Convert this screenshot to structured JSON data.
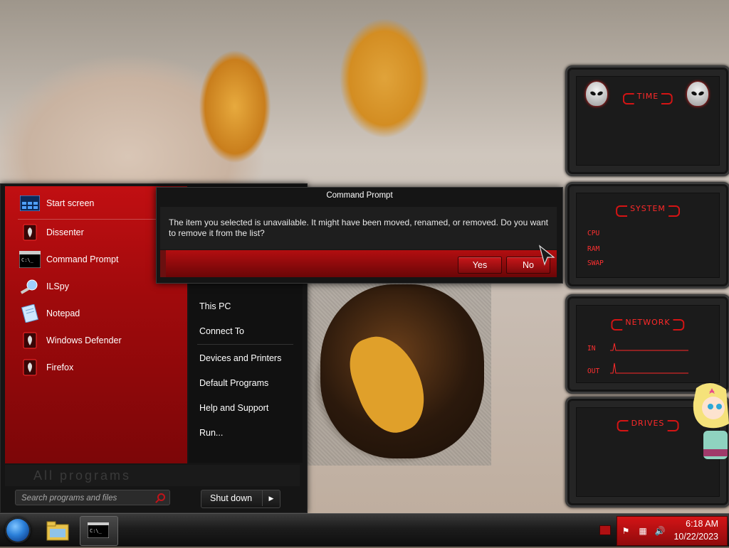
{
  "start_menu": {
    "pinned": [
      {
        "label": "Start screen",
        "icon": "start-screen-icon"
      },
      {
        "label": "Dissenter",
        "icon": "alienware-app-icon"
      },
      {
        "label": "Command Prompt",
        "icon": "cmd-icon"
      },
      {
        "label": "ILSpy",
        "icon": "ilspy-icon"
      },
      {
        "label": "Notepad",
        "icon": "notepad-icon"
      },
      {
        "label": "Windows Defender",
        "icon": "alienware-app-icon"
      },
      {
        "label": "Firefox",
        "icon": "alienware-app-icon"
      }
    ],
    "right_items": [
      "This PC",
      "Connect To",
      "Devices and Printers",
      "Default Programs",
      "Help and Support",
      "Run..."
    ],
    "all_programs": "All programs",
    "search_placeholder": "Search programs and files",
    "shutdown_label": "Shut down"
  },
  "dialog": {
    "title": "Command Prompt",
    "message": "The item you selected is unavailable.  It might have been moved, renamed, or removed.  Do you want to remove it from the list?",
    "yes_label": "Yes",
    "no_label": "No"
  },
  "gadgets": {
    "time_title": "TIME",
    "system_title": "SYSTEM",
    "system_labels": [
      "CPU",
      "RAM",
      "SWAP"
    ],
    "network_title": "NETWORK",
    "network_labels": [
      "IN",
      "OUT"
    ],
    "drives_title": "DRIVES"
  },
  "taskbar": {
    "time": "6:18 AM",
    "date": "10/22/2023"
  },
  "colors": {
    "accent": "#c10f12",
    "dark": "#151515"
  }
}
